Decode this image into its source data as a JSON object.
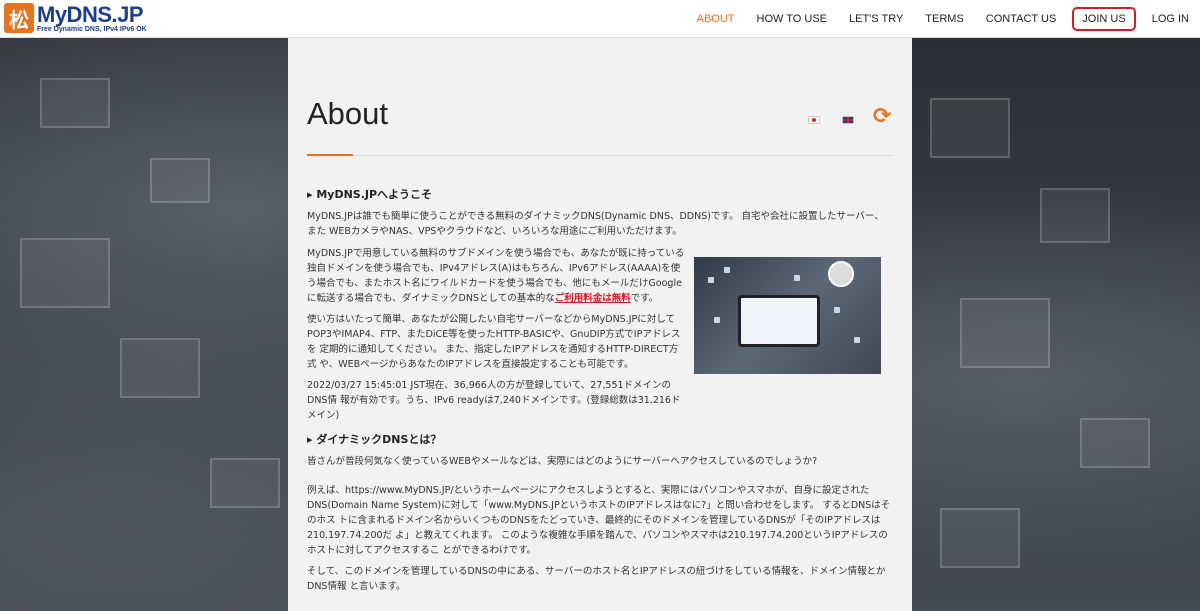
{
  "logo": {
    "title": "MyDNS.JP",
    "subtitle": "Free Dynamic DNS, IPv4 IPv6 OK",
    "mark": "松"
  },
  "nav": [
    {
      "label": "ABOUT"
    },
    {
      "label": "HOW TO USE"
    },
    {
      "label": "LET'S TRY"
    },
    {
      "label": "TERMS"
    },
    {
      "label": "CONTACT US"
    },
    {
      "label": "JOIN US"
    },
    {
      "label": "LOG IN"
    }
  ],
  "page": {
    "title": "About",
    "refresh_glyph": "⟳"
  },
  "section1": {
    "heading": "▸ MyDNS.JPへようこそ",
    "p1": "MyDNS.JPは誰でも簡単に使うことができる無料のダイナミックDNS(Dynamic DNS、DDNS)です。 自宅や会社に設置したサーバー、また WEBカメラやNAS、VPSやクラウドなど、いろいろな用途にご利用いただけます。",
    "p2_a": "MyDNS.JPで用意している無料のサブドメインを使う場合でも、あなたが既に持っている独自ドメインを使う場合でも、IPv4アドレス(A)はもちろん、IPv6アドレス(AAAA)を使う場合でも、またホスト名にワイルドカードを使う場合でも、他にもメールだけGoogleに転送する場合でも、ダイナミックDNSとしての基本的な",
    "p2_red": "ご利用料金は無料",
    "p2_b": "です。",
    "p3": "使い方はいたって簡単、あなたが公開したい自宅サーバーなどからMyDNS.JPに対して POP3やIMAP4、FTP、またDiCE等を使ったHTTP-BASICや、GnuDIP方式でIPアドレスを 定期的に通知してください。 また、指定したIPアドレスを通知するHTTP-DIRECT方式 や、WEBページからあなたのIPアドレスを直接設定することも可能です。",
    "p4": "2022/03/27 15:45:01 JST現在、36,966人の方が登録していて、27,551ドメインのDNS情 報が有効です。うち、IPv6 readyは7,240ドメインです。(登録総数は31,216ドメイン)"
  },
  "section2": {
    "heading": "▸ ダイナミックDNSとは？",
    "p1": "皆さんが普段何気なく使っているWEBやメールなどは、実際にはどのようにサーバーへアクセスしているのでしょうか?",
    "p2": "例えば、https://www.MyDNS.JP/というホームページにアクセスしようとすると、実際にはパソコンやスマホが、自身に設定された DNS(Domain Name System)に対して「www.MyDNS.JPというホストのIPアドレスはなに?」と問い合わせをします。 するとDNSはそのホス トに含まれるドメイン名からいくつものDNSをたどっていき、最終的にそのドメインを管理しているDNSが「そのIPアドレスは210.197.74.200だ よ」と教えてくれます。 このような複雑な手順を踏んで、パソコンやスマホは210.197.74.200というIPアドレスのホストに対してアクセスするこ とができるわけです。",
    "p3": "そして、このドメインを管理しているDNSの中にある、サーバーのホスト名とIPアドレスの紐づけをしている情報を、ドメイン情報とかDNS情報 と言います。"
  },
  "colors": {
    "accent": "#e8731f",
    "brand": "#1a3d8f",
    "highlight": "#d01f2a"
  }
}
